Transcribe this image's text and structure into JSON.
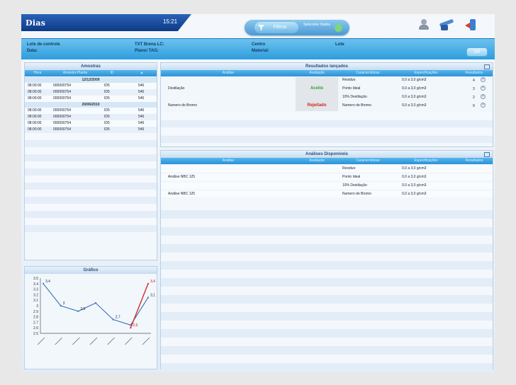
{
  "brand": {
    "name": "Dias",
    "subtitle": "",
    "time": "15:21"
  },
  "tabs": {
    "filtros": "Filtros",
    "second": "Selecione Dados"
  },
  "info": {
    "lote_label": "Lote de controle",
    "data_label": "Data:",
    "txt_label": "TXT Brena LC:",
    "plano_label": "Plano/ TAG:",
    "centro_label": "Centro",
    "material_label": "Material:",
    "lote2_label": "Lote",
    "ok_button": "OK"
  },
  "amostras": {
    "title": "Amostras",
    "columns": [
      "Hora",
      "Amostra Planta",
      "ID",
      ""
    ],
    "groups": [
      {
        "date": "12/12/2009",
        "rows": [
          [
            "08:00:00",
            "000000754",
            "ID5",
            "546"
          ],
          [
            "08:00:00",
            "000000754",
            "ID5",
            "546"
          ],
          [
            "08:00:00",
            "000000754",
            "ID5",
            "546"
          ]
        ]
      },
      {
        "date": "20/06/2010",
        "rows": [
          [
            "08:00:00",
            "000000754",
            "ID5",
            "546"
          ],
          [
            "08:00:00",
            "000000754",
            "ID5",
            "546"
          ],
          [
            "08:00:00",
            "000000754",
            "ID5",
            "546"
          ],
          [
            "08:00:00",
            "000000754",
            "ID5",
            "546"
          ]
        ]
      }
    ]
  },
  "resultados": {
    "title": "Resultados lançados",
    "columns": [
      "Análise",
      "Avaliação",
      "Características",
      "Especificações",
      "Resultados"
    ],
    "rows": [
      {
        "analise": "",
        "avaliacao": "",
        "carac": "Residuo",
        "espec": "0,0 a 3,0 g/cm3",
        "res": "4"
      },
      {
        "analise": "Destilação",
        "avaliacao": "Aceito",
        "carac": "Ponto Ideal",
        "espec": "0,0 a 3,0 g/cm3",
        "res": "3"
      },
      {
        "analise": "",
        "avaliacao": "",
        "carac": "10% Destilação",
        "espec": "0,0 a 3,0 g/cm3",
        "res": "2"
      },
      {
        "analise": "Numero de Bromo",
        "avaliacao": "Rejeitado",
        "carac": "Numero de Bromo",
        "espec": "0,0 a 3,0 g/cm3",
        "res": "9"
      }
    ]
  },
  "disponiveis": {
    "title": "Análises Disponíveis",
    "columns": [
      "Análise",
      "Avaliação",
      "Características",
      "Especificações",
      "Resultados"
    ],
    "rows": [
      {
        "analise": "",
        "carac": "Residuo",
        "espec": "0,0 a 3,0 g/cm3"
      },
      {
        "analise": "Análise NBC 125",
        "carac": "Ponto Ideal",
        "espec": "0,0 a 3,0 g/cm3"
      },
      {
        "analise": "",
        "carac": "10% Destilação",
        "espec": "0,0 a 3,0 g/cm3"
      },
      {
        "analise": "Análise NBC 125",
        "carac": "Numero de Bromo",
        "espec": "0,0 a 3,0 g/cm3"
      }
    ]
  },
  "grafico": {
    "title": "Gráfico"
  },
  "chart_data": {
    "type": "line",
    "title": "Gráfico",
    "ylim": [
      2.5,
      3.5
    ],
    "yticks": [
      "3.5",
      "3.4",
      "3.3",
      "3.2",
      "3.1",
      "3",
      "2.9",
      "2.8",
      "2.7",
      "2.6",
      "2.5"
    ],
    "xticks": [
      "",
      "",
      "",
      "",
      "",
      "",
      ""
    ],
    "series": [
      {
        "values": [
          3.4,
          3.0,
          2.9,
          3.05,
          2.75,
          2.65,
          3.15
        ],
        "color": "#3d6fb6"
      },
      {
        "values": [
          null,
          null,
          null,
          null,
          null,
          2.6,
          3.4
        ],
        "color": "#d42a2a"
      }
    ],
    "labels": [
      {
        "i": 0,
        "text": "3,4",
        "s": 0
      },
      {
        "i": 1,
        "text": "3",
        "s": 0
      },
      {
        "i": 2,
        "text": "2,9",
        "s": 0
      },
      {
        "i": 4,
        "text": "2,7",
        "s": 0
      },
      {
        "i": 5,
        "text": "2,6",
        "s": 1
      },
      {
        "i": 6,
        "text": "3,4",
        "s": 1
      },
      {
        "i": 6,
        "text": "3,1",
        "s": 0
      }
    ]
  },
  "colors": {
    "accept": "#2f9d3a",
    "reject": "#d1241a"
  }
}
